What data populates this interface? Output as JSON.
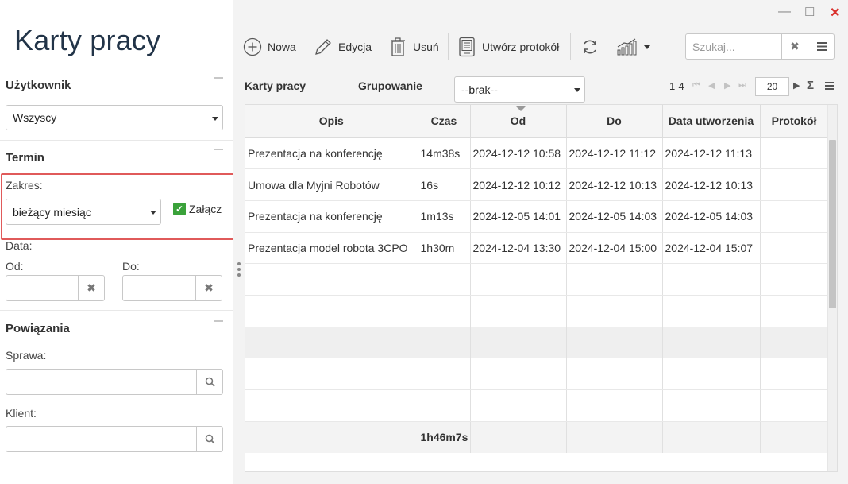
{
  "app": {
    "title": "Karty pracy"
  },
  "window": {
    "minimize": "—",
    "maximize": "☐",
    "close": "✕"
  },
  "filters": {
    "user": {
      "title": "Użytkownik",
      "value": "Wszyscy"
    },
    "term": {
      "title": "Termin",
      "range_label": "Zakres:",
      "range_value": "bieżący miesiąc",
      "include_label": "Załącz",
      "include_checked": true,
      "date_label": "Data:",
      "from_label": "Od:",
      "to_label": "Do:"
    },
    "links": {
      "title": "Powiązania",
      "case_label": "Sprawa:",
      "client_label": "Klient:"
    }
  },
  "toolbar": {
    "new_label": "Nowa",
    "edit_label": "Edycja",
    "delete_label": "Usuń",
    "protocol_label": "Utwórz protokół",
    "search_placeholder": "Szukaj..."
  },
  "grid": {
    "title": "Karty pracy",
    "grouping_label": "Grupowanie",
    "grouping_value": "--brak--",
    "range": "1-4",
    "page_size": "20",
    "columns": [
      "Opis",
      "Czas",
      "Od",
      "Do",
      "Data utworzenia",
      "Protokół"
    ],
    "sorted_column": "Od",
    "rows": [
      {
        "opis": "Prezentacja na konferencję",
        "czas": "14m38s",
        "od": "2024-12-12 10:58",
        "do": "2024-12-12 11:12",
        "utw": "2024-12-12 11:13",
        "prot": ""
      },
      {
        "opis": "Umowa dla Myjni Robotów",
        "czas": "16s",
        "od": "2024-12-12 10:12",
        "do": "2024-12-12 10:13",
        "utw": "2024-12-12 10:13",
        "prot": ""
      },
      {
        "opis": "Prezentacja na konferencję",
        "czas": "1m13s",
        "od": "2024-12-05 14:01",
        "do": "2024-12-05 14:03",
        "utw": "2024-12-05 14:03",
        "prot": ""
      },
      {
        "opis": "Prezentacja model robota 3CPO",
        "czas": "1h30m",
        "od": "2024-12-04 13:30",
        "do": "2024-12-04 15:00",
        "utw": "2024-12-04 15:07",
        "prot": ""
      }
    ],
    "total_time": "1h46m7s"
  }
}
